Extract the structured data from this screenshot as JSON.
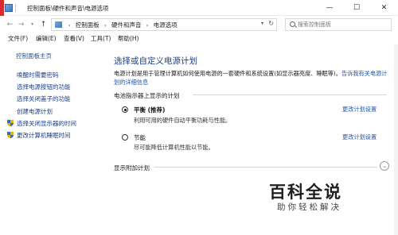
{
  "window": {
    "title": "控制面板\\硬件和声音\\电源选项",
    "minimize": "—",
    "maximize": "☐",
    "close": "✕"
  },
  "address": {
    "crumbs": [
      "控制面板",
      "硬件和声音",
      "电源选项"
    ],
    "search_placeholder": "搜索控制面板"
  },
  "menu": {
    "file": "文件(F)",
    "edit": "编辑(E)",
    "view": "查看(V)",
    "tools": "工具(T)",
    "help": "帮助(H)"
  },
  "sidebar": {
    "home": "控制面板主页",
    "items": [
      "唤醒时需要密码",
      "选择电源按钮的功能",
      "选择关闭盖子的功能",
      "创建电源计划",
      "选择关闭显示器的时间",
      "更改计算机睡眠时间"
    ]
  },
  "main": {
    "title": "选择或自定义电源计划",
    "description": "电源计划是用于管理计算机如何使用电源的一套硬件和系统设置(如显示器亮度、睡眠等)。",
    "description_link": "告诉我有关电源计划的详细信息",
    "battery_group": "电池指示器上显示的计划",
    "plans": [
      {
        "name": "平衡 (推荐)",
        "desc": "利用可用的硬件自动平衡功耗与性能。",
        "link": "更改计划设置",
        "selected": true
      },
      {
        "name": "节能",
        "desc": "尽可能降低计算机性能以节能。",
        "link": "更改计划设置",
        "selected": false
      }
    ],
    "extra_plans": "显示附加计划"
  },
  "watermark": {
    "title": "百科全说",
    "subtitle": "助你轻松解决"
  },
  "colors": {
    "link": "#1f55b0",
    "heading": "#1e3f86",
    "close_hover": "#e81123"
  }
}
